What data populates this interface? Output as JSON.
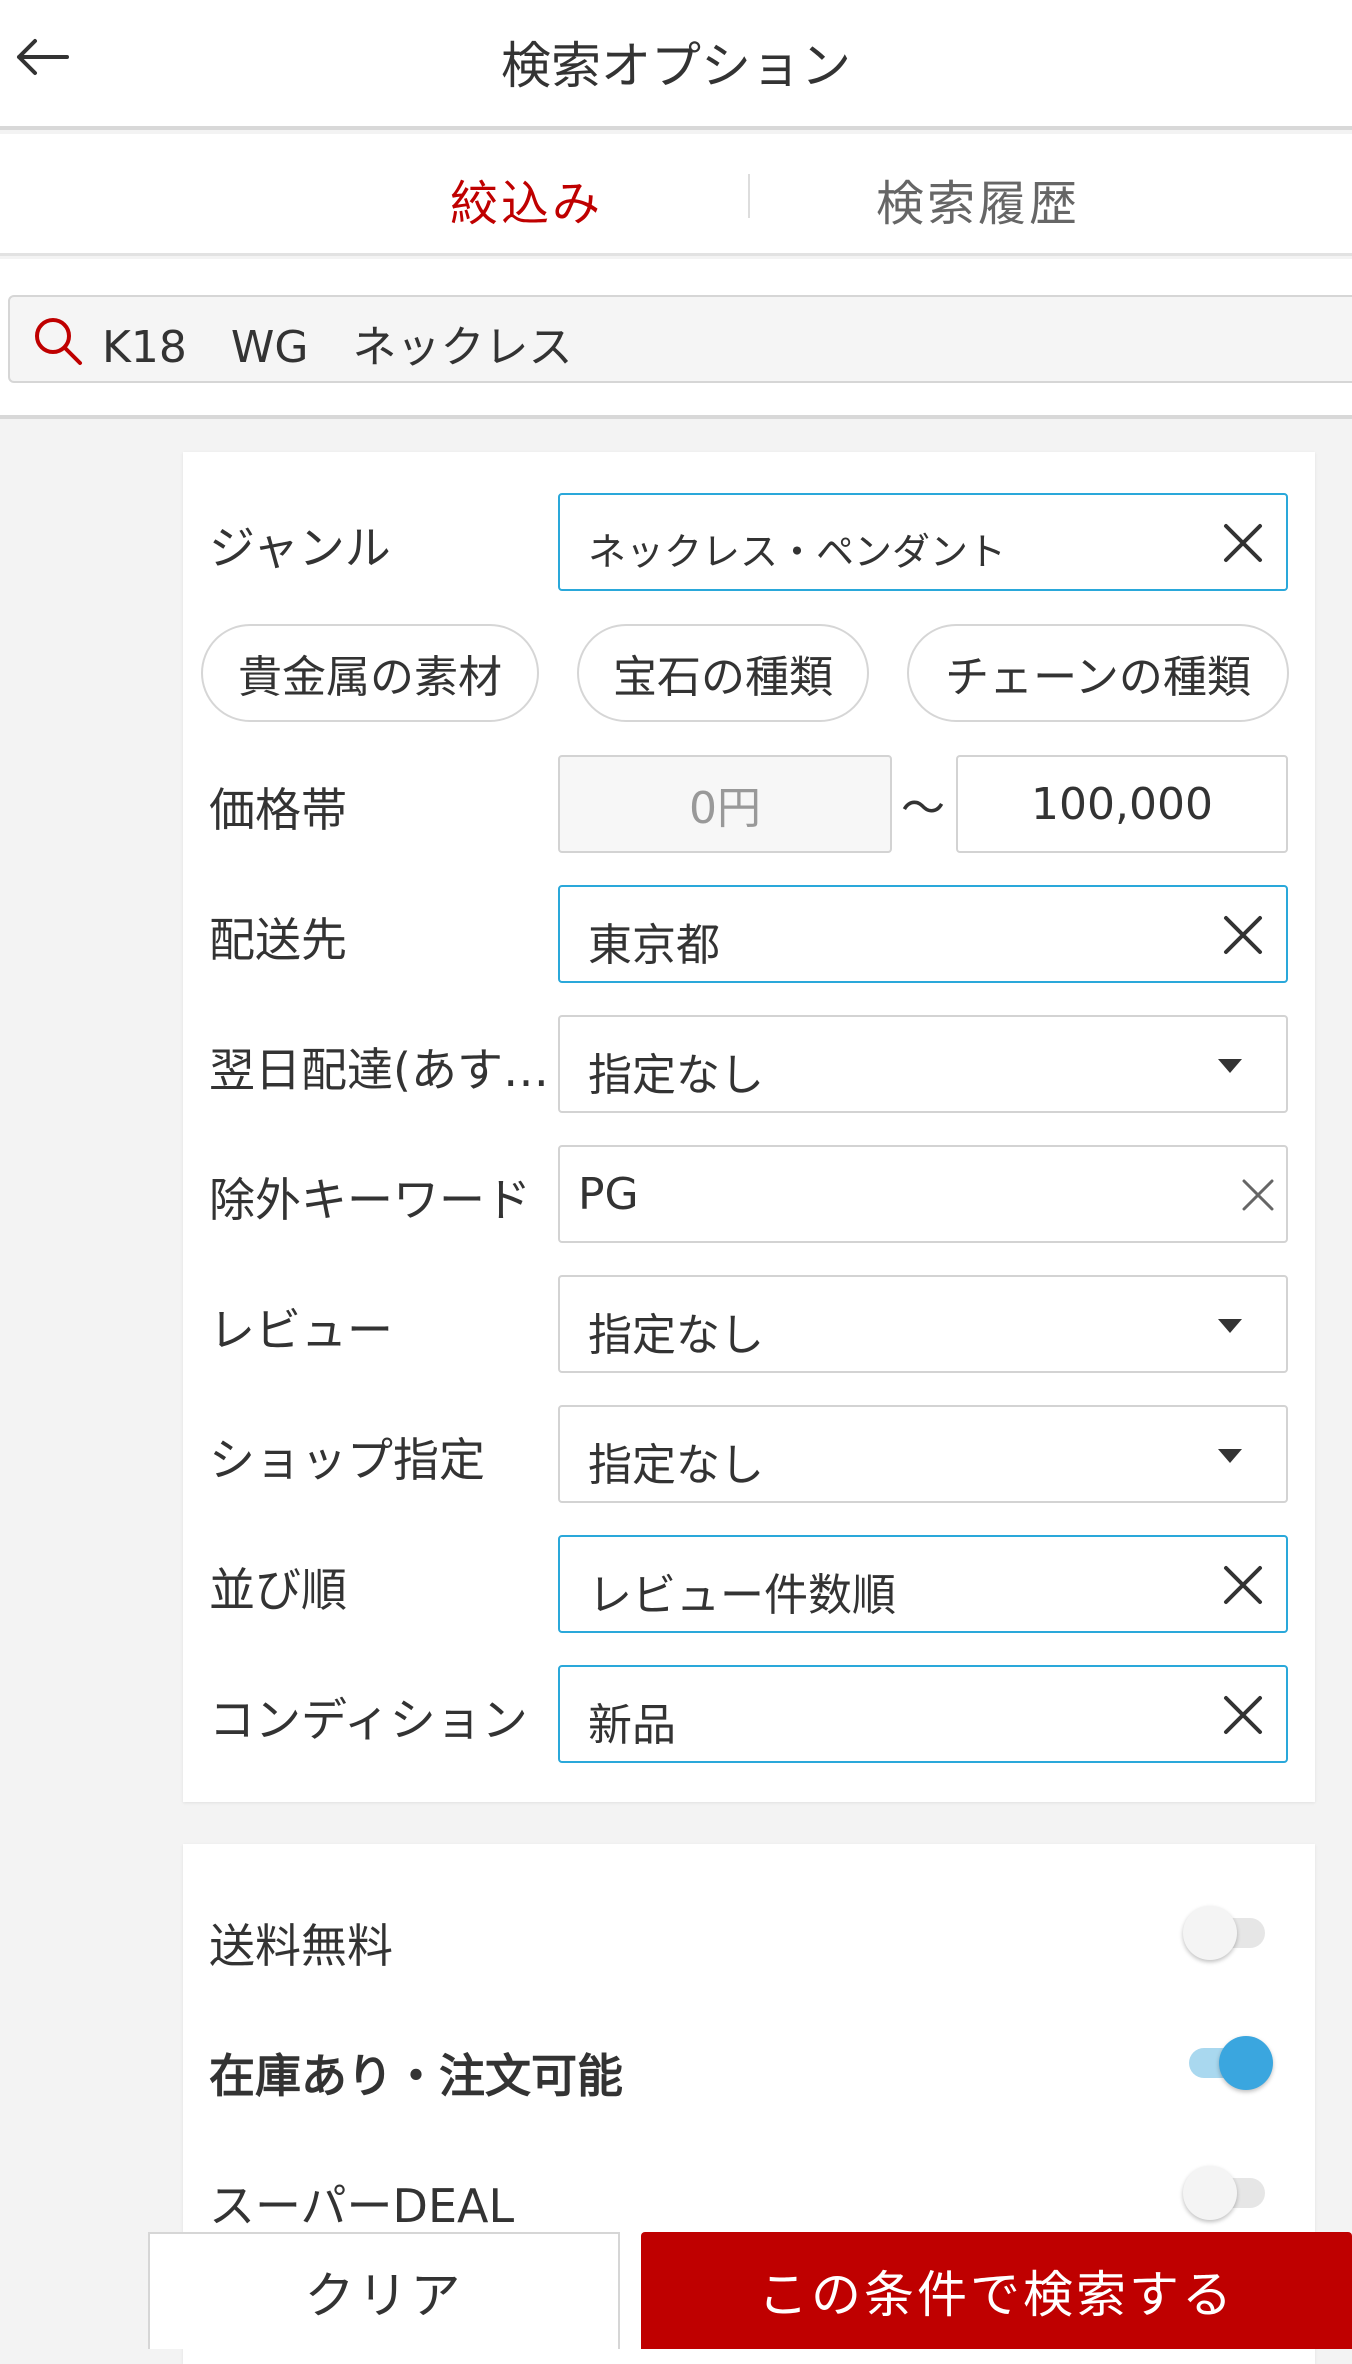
{
  "header": {
    "title": "検索オプション",
    "back_icon": "arrow-left-icon"
  },
  "tabs": [
    {
      "label": "絞込み",
      "active": true
    },
    {
      "label": "検索履歴",
      "active": false
    }
  ],
  "search": {
    "query": "K18　WG　ネックレス",
    "icon": "search-icon"
  },
  "filters": {
    "genre": {
      "label": "ジャンル",
      "value": "ネックレス・ペンダント"
    },
    "chips": [
      "貴金属の素材",
      "宝石の種類",
      "チェーンの種類"
    ],
    "price": {
      "label": "価格帯",
      "min_placeholder": "0円",
      "separator": "〜",
      "max_value": "100,000"
    },
    "delivery_area": {
      "label": "配送先",
      "value": "東京都"
    },
    "next_day": {
      "label": "翌日配達(あす…",
      "value": "指定なし"
    },
    "exclude_keyword": {
      "label": "除外キーワード",
      "value": "PG"
    },
    "review": {
      "label": "レビュー",
      "value": "指定なし"
    },
    "shop": {
      "label": "ショップ指定",
      "value": "指定なし"
    },
    "sort": {
      "label": "並び順",
      "value": "レビュー件数順"
    },
    "condition": {
      "label": "コンディション",
      "value": "新品"
    }
  },
  "toggles": [
    {
      "label": "送料無料",
      "on": false
    },
    {
      "label": "在庫あり・注文可能",
      "on": true
    },
    {
      "label": "スーパーDEAL",
      "on": false
    }
  ],
  "footer": {
    "clear_label": "クリア",
    "submit_label": "この条件で検索する"
  },
  "colors": {
    "accent_red": "#bf0000",
    "active_blue": "#2aa8da",
    "toggle_on": "#3aa6df"
  }
}
